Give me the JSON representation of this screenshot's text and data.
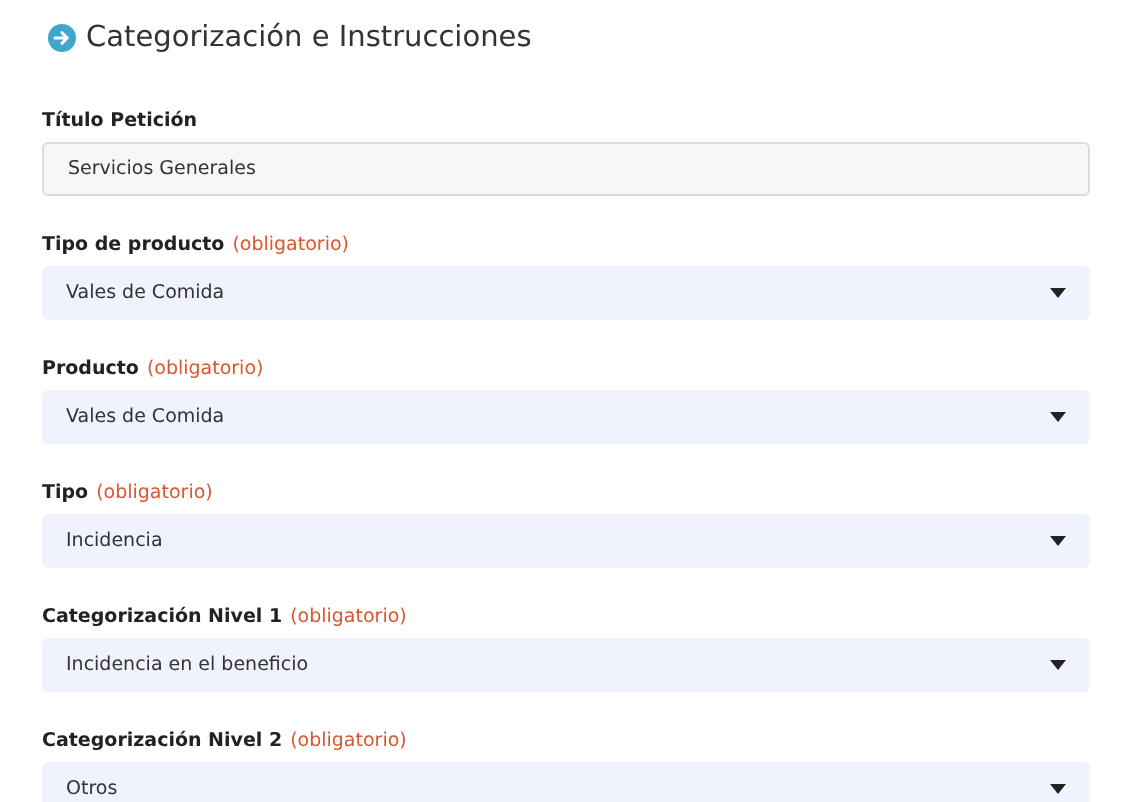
{
  "section": {
    "title": "Categorización e Instrucciones"
  },
  "fields": [
    {
      "label": "Título Petición",
      "kind": "text",
      "value": "Servicios Generales"
    },
    {
      "label": "Tipo de producto",
      "required_note": "(obligatorio)",
      "kind": "select",
      "value": "Vales de Comida"
    },
    {
      "label": "Producto",
      "required_note": "(obligatorio)",
      "kind": "select",
      "value": "Vales de Comida"
    },
    {
      "label": "Tipo",
      "required_note": "(obligatorio)",
      "kind": "select",
      "value": "Incidencia"
    },
    {
      "label": "Categorización Nivel 1",
      "required_note": "(obligatorio)",
      "kind": "select",
      "value": "Incidencia en el beneficio"
    },
    {
      "label": "Categorización Nivel 2",
      "required_note": "(obligatorio)",
      "kind": "select",
      "value": "Otros"
    }
  ]
}
